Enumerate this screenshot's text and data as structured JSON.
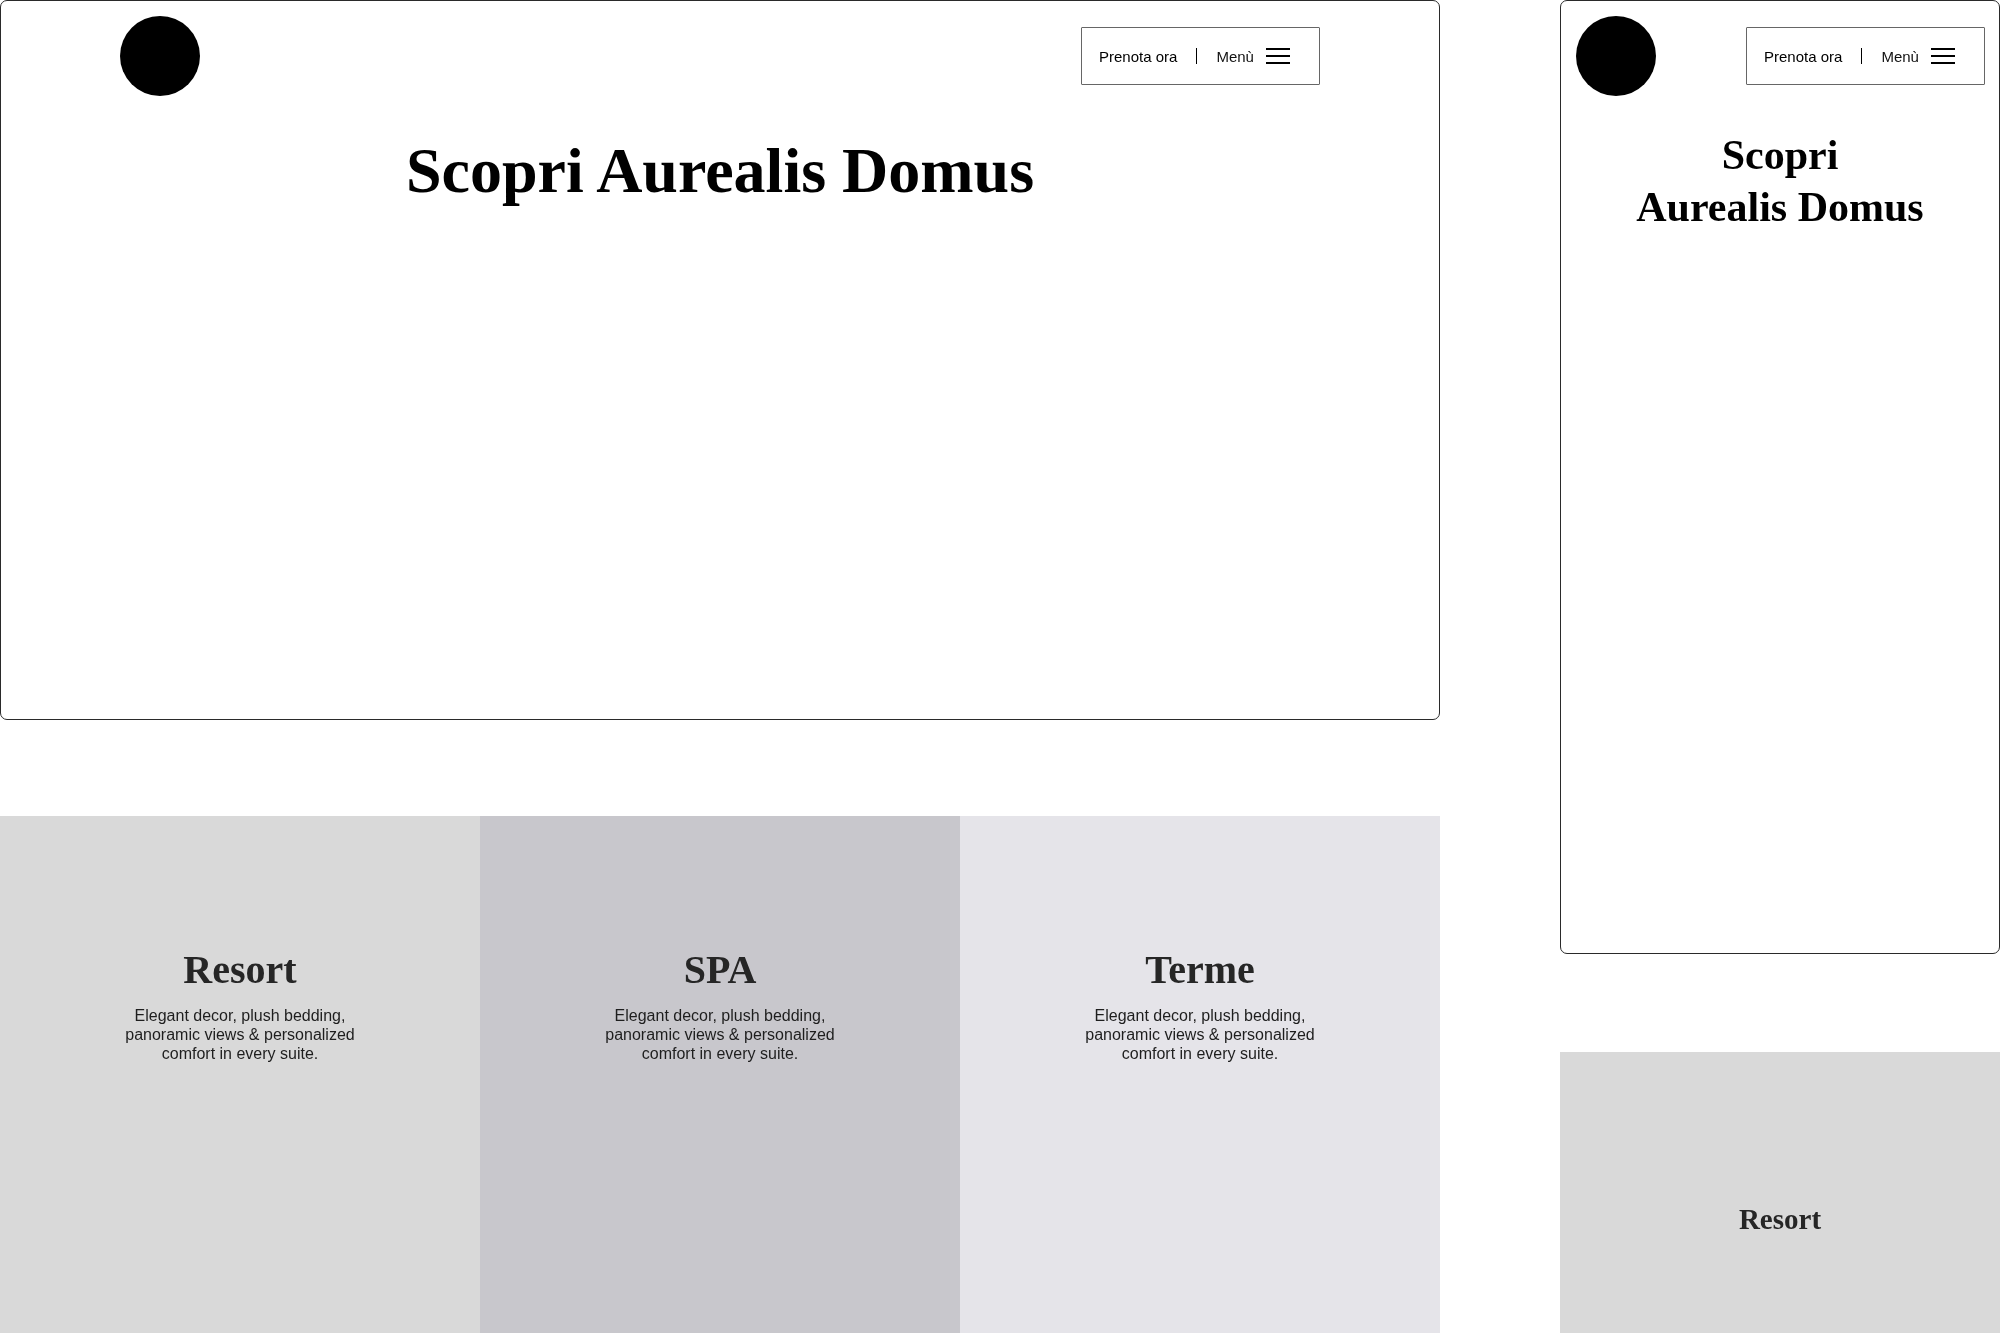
{
  "desktop": {
    "header": {
      "book_label": "Prenota ora",
      "menu_label": "Menù"
    },
    "title": "Scopri Aurealis Domus",
    "cards": [
      {
        "title": "Resort",
        "description": "Elegant decor, plush bedding, panoramic views & personalized comfort in every suite.",
        "color": "#d9d9d9"
      },
      {
        "title": "SPA",
        "description": "Elegant decor, plush bedding, panoramic views & personalized comfort in every suite.",
        "color": "#c8c7cc"
      },
      {
        "title": "Terme",
        "description": "Elegant decor, plush bedding, panoramic views & personalized comfort in every suite.",
        "color": "#e5e4e9"
      }
    ]
  },
  "mobile": {
    "header": {
      "book_label": "Prenota ora",
      "menu_label": "Menù"
    },
    "title_lines": [
      "Scopri",
      "Aurealis Domus"
    ],
    "cards": [
      {
        "title": "Resort",
        "color": "#d9d9d9"
      }
    ]
  }
}
